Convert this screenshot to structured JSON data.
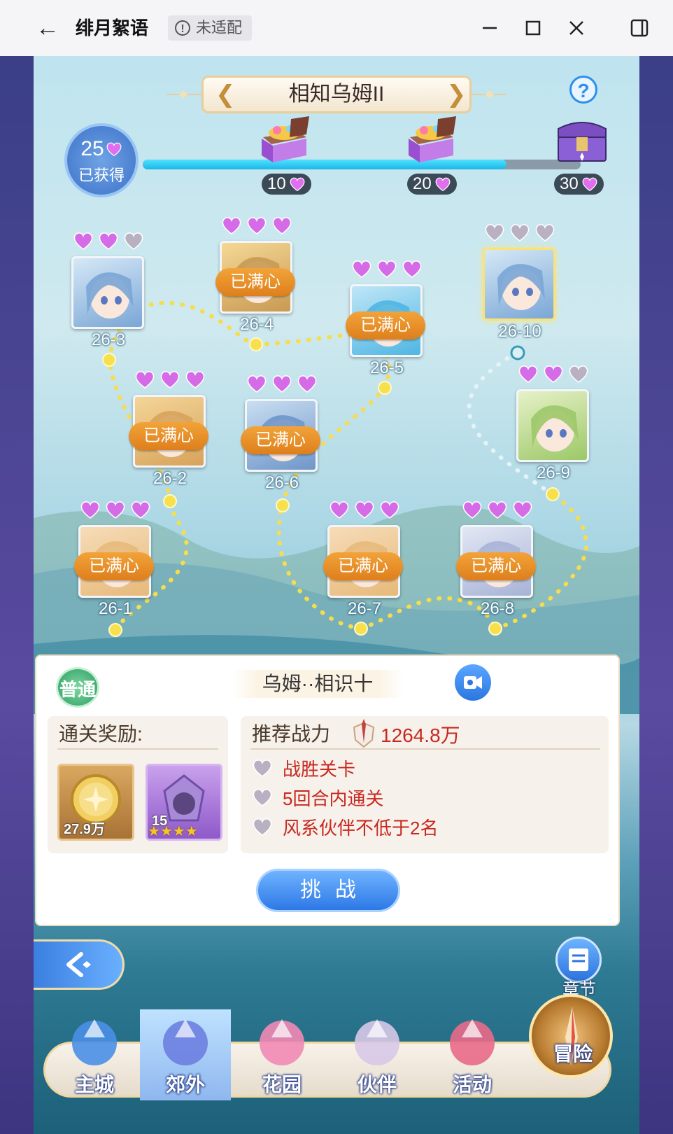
{
  "window": {
    "title": "绯月絮语",
    "badge": "未适配",
    "controls": [
      "minimize",
      "maximize",
      "close",
      "side-panel"
    ]
  },
  "header": {
    "chapter_title": "相知乌姆II",
    "prev_icon": "chevron-left-icon",
    "next_icon": "chevron-right-icon",
    "help_icon": "question-icon",
    "help_label": "?"
  },
  "progress": {
    "hearts": "25",
    "hearts_label": "已获得",
    "fraction": 0.83,
    "milestones": [
      {
        "value": "10",
        "icon": "treasure-chest-icon"
      },
      {
        "value": "20",
        "icon": "treasure-chest-icon"
      },
      {
        "value": "30",
        "icon": "treasure-chest-locked-icon"
      }
    ]
  },
  "levels": [
    {
      "id": "26-1",
      "hearts": 3,
      "full": true,
      "full_label": "已满心",
      "selected": false
    },
    {
      "id": "26-2",
      "hearts": 3,
      "full": true,
      "full_label": "已满心",
      "selected": false
    },
    {
      "id": "26-3",
      "hearts": 2,
      "full": false,
      "full_label": "",
      "selected": false
    },
    {
      "id": "26-4",
      "hearts": 3,
      "full": true,
      "full_label": "已满心",
      "selected": false
    },
    {
      "id": "26-5",
      "hearts": 3,
      "full": true,
      "full_label": "已满心",
      "selected": false
    },
    {
      "id": "26-6",
      "hearts": 3,
      "full": true,
      "full_label": "已满心",
      "selected": false
    },
    {
      "id": "26-7",
      "hearts": 3,
      "full": true,
      "full_label": "已满心",
      "selected": false
    },
    {
      "id": "26-8",
      "hearts": 3,
      "full": true,
      "full_label": "已满心",
      "selected": false
    },
    {
      "id": "26-9",
      "hearts": 2,
      "full": false,
      "full_label": "",
      "selected": false
    },
    {
      "id": "26-10",
      "hearts": 0,
      "full": false,
      "full_label": "",
      "selected": true
    }
  ],
  "stage": {
    "difficulty": "普通",
    "name": "乌姆··相识十",
    "video_icon": "video-camera-icon",
    "rewards_title": "通关奖励:",
    "rewards": [
      {
        "icon": "gold-coin-icon",
        "count": "27.9万"
      },
      {
        "icon": "purple-crystal-icon",
        "count": "15",
        "stars": 4
      }
    ],
    "power_label": "推荐战力",
    "power_value": "1264.8万",
    "requirements": [
      "战胜关卡",
      "5回合内通关",
      "风系伙伴不低于2名"
    ],
    "challenge_label": "挑战"
  },
  "side": {
    "chapter_label": "章节",
    "back_icon": "back-arrow-icon"
  },
  "nav": [
    {
      "label": "主城",
      "icon": "castle-icon",
      "active": false
    },
    {
      "label": "郊外",
      "icon": "hexagram-gate-icon",
      "active": true
    },
    {
      "label": "花园",
      "icon": "heart-garden-icon",
      "active": false
    },
    {
      "label": "伙伴",
      "icon": "partner-portrait-icon",
      "active": false
    },
    {
      "label": "活动",
      "icon": "gift-box-icon",
      "active": false
    },
    {
      "label": "冒险",
      "icon": "compass-icon",
      "active": false
    }
  ],
  "colors": {
    "full_badge": "#e8902a",
    "heart_filled": "#d66be8",
    "heart_empty": "#b9b0c2",
    "progress_fill": "#22c3ef",
    "accent_blue": "#2f7fe6",
    "requirement_red": "#c8281f"
  }
}
